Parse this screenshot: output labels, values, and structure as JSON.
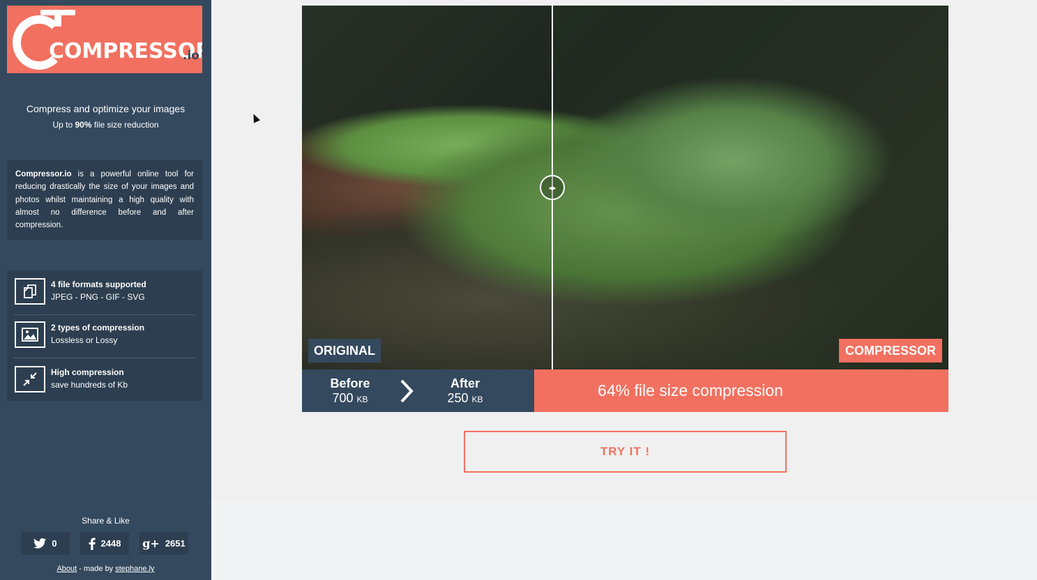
{
  "logo": {
    "brand": "COMPRESSOR",
    "tld": ".io"
  },
  "intro": {
    "tagline": "Compress and optimize your images",
    "subtag_prefix": "Up to ",
    "subtag_bold": "90%",
    "subtag_suffix": " file size reduction"
  },
  "description": {
    "brand": "Compressor.io",
    "text": " is a powerful online tool for reducing drastically the size of your images and photos whilst maintaining a high quality with almost no difference before and after compression."
  },
  "features": [
    {
      "icon": "file-formats-icon",
      "title": "4 file formats supported",
      "subtitle": "JPEG - PNG - GIF - SVG"
    },
    {
      "icon": "image-icon",
      "title": "2 types of compression",
      "subtitle": "Lossless or Lossy"
    },
    {
      "icon": "compress-arrows-icon",
      "title": "High compression",
      "subtitle": "save hundreds of Kb"
    }
  ],
  "share": {
    "title": "Share & Like",
    "twitter_count": "0",
    "facebook_count": "2448",
    "gplus_count": "2651"
  },
  "footer": {
    "about": "About",
    "made_by": " - made by ",
    "author": "stephane.ly"
  },
  "comparison": {
    "label_original": "ORIGINAL",
    "label_compressor": "COMPRESSOR",
    "before_title": "Before",
    "before_value": "700",
    "before_unit": "KB",
    "after_title": "After",
    "after_value": "250",
    "after_unit": "KB",
    "result": "64% file size compression"
  },
  "cta": {
    "label": "TRY IT !"
  },
  "colors": {
    "accent": "#f1705f",
    "sidebar": "#34495e",
    "panel": "#2c3e50"
  }
}
